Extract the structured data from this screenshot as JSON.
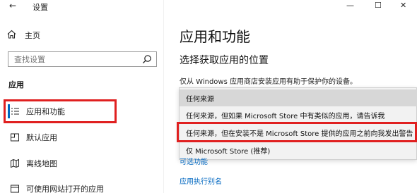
{
  "window": {
    "title": "设置",
    "back_icon": "back-arrow-icon",
    "controls": {
      "minimize": "—",
      "maximize": "☐",
      "close": "✕"
    }
  },
  "sidebar": {
    "home_label": "主页",
    "search_placeholder": "查找设置",
    "section_label": "应用",
    "items": [
      {
        "label": "应用和功能",
        "icon": "apps-list-icon",
        "active": true
      },
      {
        "label": "默认应用",
        "icon": "default-apps-icon",
        "active": false
      },
      {
        "label": "离线地图",
        "icon": "offline-maps-icon",
        "active": false
      },
      {
        "label": "可使用网站打开的应用",
        "icon": "apps-for-websites-icon",
        "active": false
      }
    ]
  },
  "main": {
    "title": "应用和功能",
    "subtitle": "选择获取应用的位置",
    "description": "仅从 Windows 应用商店安装应用有助于保护你的设备。",
    "dropdown": {
      "options": [
        "任何来源",
        "任何来源，但如果 Microsoft Store 中有类似的应用，请告诉我",
        "任何来源，但在安装不是 Microsoft Store 提供的应用之前向我发出警告",
        "仅 Microsoft Store (推荐)"
      ],
      "highlighted_index": 0,
      "annotated_index": 2
    },
    "links": {
      "optional_features": "可选功能",
      "app_aliases": "应用执行别名"
    }
  },
  "colors": {
    "accent": "#0067c0",
    "annotation_red": "#e02020",
    "dropdown_bg": "#f2f2f2",
    "hover_bg": "#d7d7d7"
  }
}
